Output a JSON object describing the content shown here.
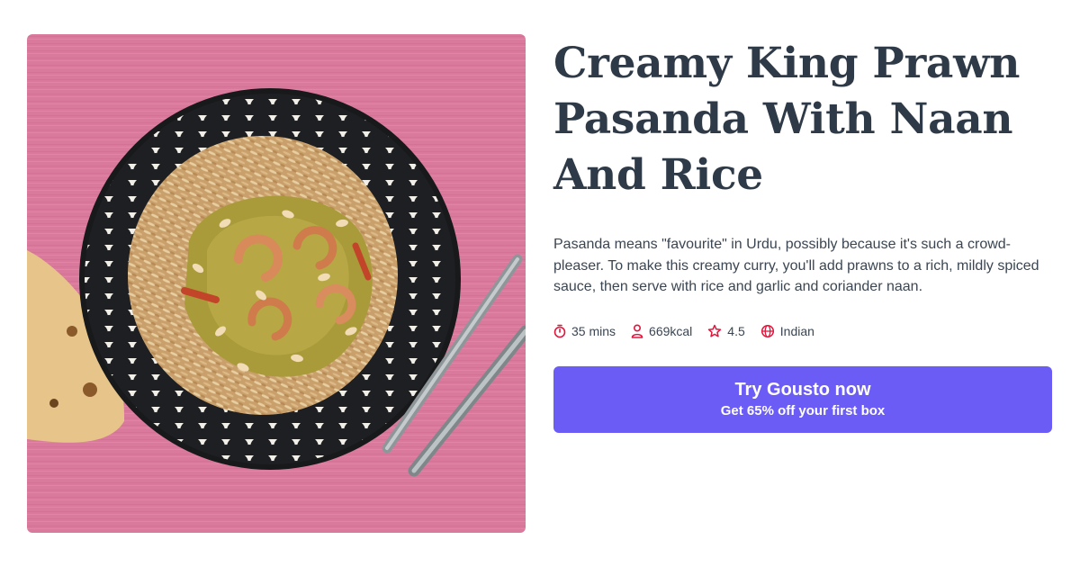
{
  "recipe": {
    "title": "Creamy King Prawn Pasanda With Naan And Rice",
    "description": "Pasanda means \"favourite\" in Urdu, possibly because it's such a crowd-pleaser. To make this creamy curry, you'll add prawns to a rich, mildly spiced sauce, then serve with rice and garlic and coriander naan.",
    "image_alt": "Plate of creamy king prawn pasanda with rice, naan and cutlery on a pink table"
  },
  "meta": {
    "time": "35 mins",
    "time_icon": "stopwatch-icon",
    "calories": "669kcal",
    "calories_icon": "person-icon",
    "rating": "4.5",
    "rating_icon": "star-icon",
    "cuisine": "Indian",
    "cuisine_icon": "globe-icon",
    "icon_color": "#e0163d"
  },
  "cta": {
    "label": "Try Gousto now",
    "sublabel": "Get 65% off your first box",
    "color": "#6b5cf6"
  }
}
